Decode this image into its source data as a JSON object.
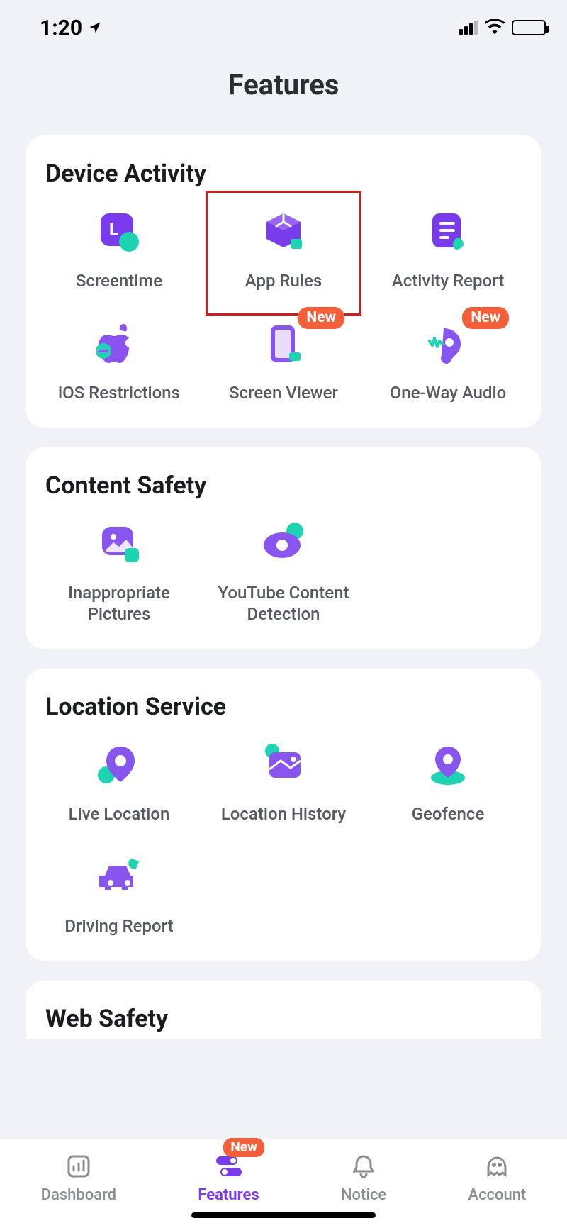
{
  "status": {
    "time": "1:20"
  },
  "page_title": "Features",
  "sections": {
    "device_activity": {
      "title": "Device Activity",
      "items": [
        {
          "label": "Screentime",
          "icon": "clock-icon"
        },
        {
          "label": "App Rules",
          "icon": "cube-icon",
          "highlighted": true
        },
        {
          "label": "Activity Report",
          "icon": "report-icon"
        },
        {
          "label": "iOS Restrictions",
          "icon": "apple-icon"
        },
        {
          "label": "Screen Viewer",
          "icon": "phone-icon",
          "badge": "New"
        },
        {
          "label": "One-Way Audio",
          "icon": "ear-icon",
          "badge": "New"
        }
      ]
    },
    "content_safety": {
      "title": "Content Safety",
      "items": [
        {
          "label": "Inappropriate Pictures",
          "icon": "image-icon"
        },
        {
          "label": "YouTube Content Detection",
          "icon": "eye-icon"
        }
      ]
    },
    "location_service": {
      "title": "Location Service",
      "items": [
        {
          "label": "Live Location",
          "icon": "pin-icon"
        },
        {
          "label": "Location History",
          "icon": "map-icon"
        },
        {
          "label": "Geofence",
          "icon": "geofence-icon"
        },
        {
          "label": "Driving Report",
          "icon": "car-icon"
        }
      ]
    },
    "web_safety": {
      "title": "Web Safety"
    }
  },
  "nav": {
    "items": [
      {
        "label": "Dashboard",
        "icon": "dashboard-icon"
      },
      {
        "label": "Features",
        "icon": "toggles-icon",
        "active": true,
        "badge": "New"
      },
      {
        "label": "Notice",
        "icon": "bell-icon"
      },
      {
        "label": "Account",
        "icon": "ghost-icon"
      }
    ]
  },
  "colors": {
    "accent": "#7a3bec",
    "teal": "#1ed3b2",
    "badge": "#f35e3b"
  }
}
